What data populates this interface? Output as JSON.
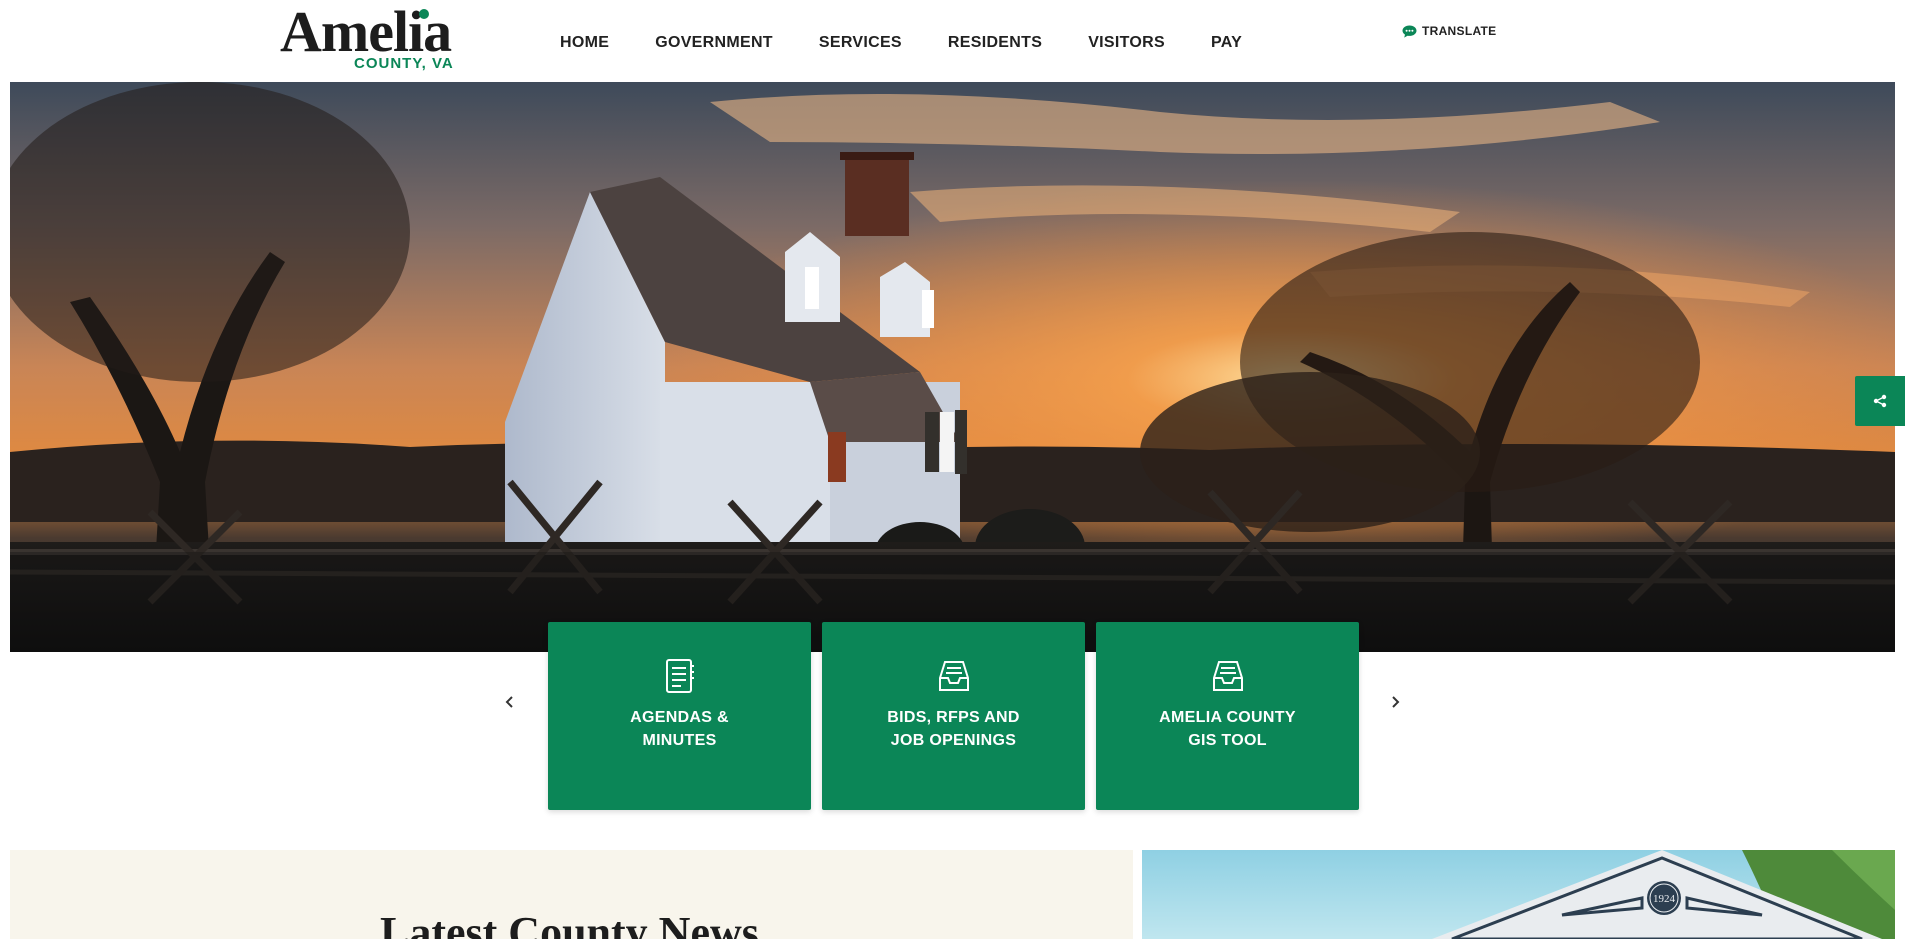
{
  "header": {
    "logo_main": "Amelia",
    "logo_sub": "COUNTY, VA",
    "nav": [
      {
        "label": "HOME"
      },
      {
        "label": "GOVERNMENT"
      },
      {
        "label": "SERVICES"
      },
      {
        "label": "RESIDENTS"
      },
      {
        "label": "VISITORS"
      },
      {
        "label": "PAY"
      }
    ],
    "translate_label": "TRANSLATE",
    "translate_icon": "chat-bubble-icon"
  },
  "hero": {
    "image": "sunset-farmhouse-photo"
  },
  "share": {
    "icon": "share-icon"
  },
  "quick_links": [
    {
      "line1": "AGENDAS &",
      "line2": "MINUTES",
      "icon": "notebook-icon"
    },
    {
      "line1": "BIDS, RFPS AND",
      "line2": "JOB OPENINGS",
      "icon": "inbox-tray-icon"
    },
    {
      "line1": "AMELIA COUNTY",
      "line2": "GIS TOOL",
      "icon": "inbox-tray-icon"
    }
  ],
  "carousel": {
    "prev_icon": "chevron-left-icon",
    "next_icon": "chevron-right-icon"
  },
  "news": {
    "title": "Latest County News"
  },
  "building_badge": "1924",
  "colors": {
    "brand_green": "#0b8657",
    "text_dark": "#1d1d1d",
    "news_bg": "#f8f5ec"
  }
}
